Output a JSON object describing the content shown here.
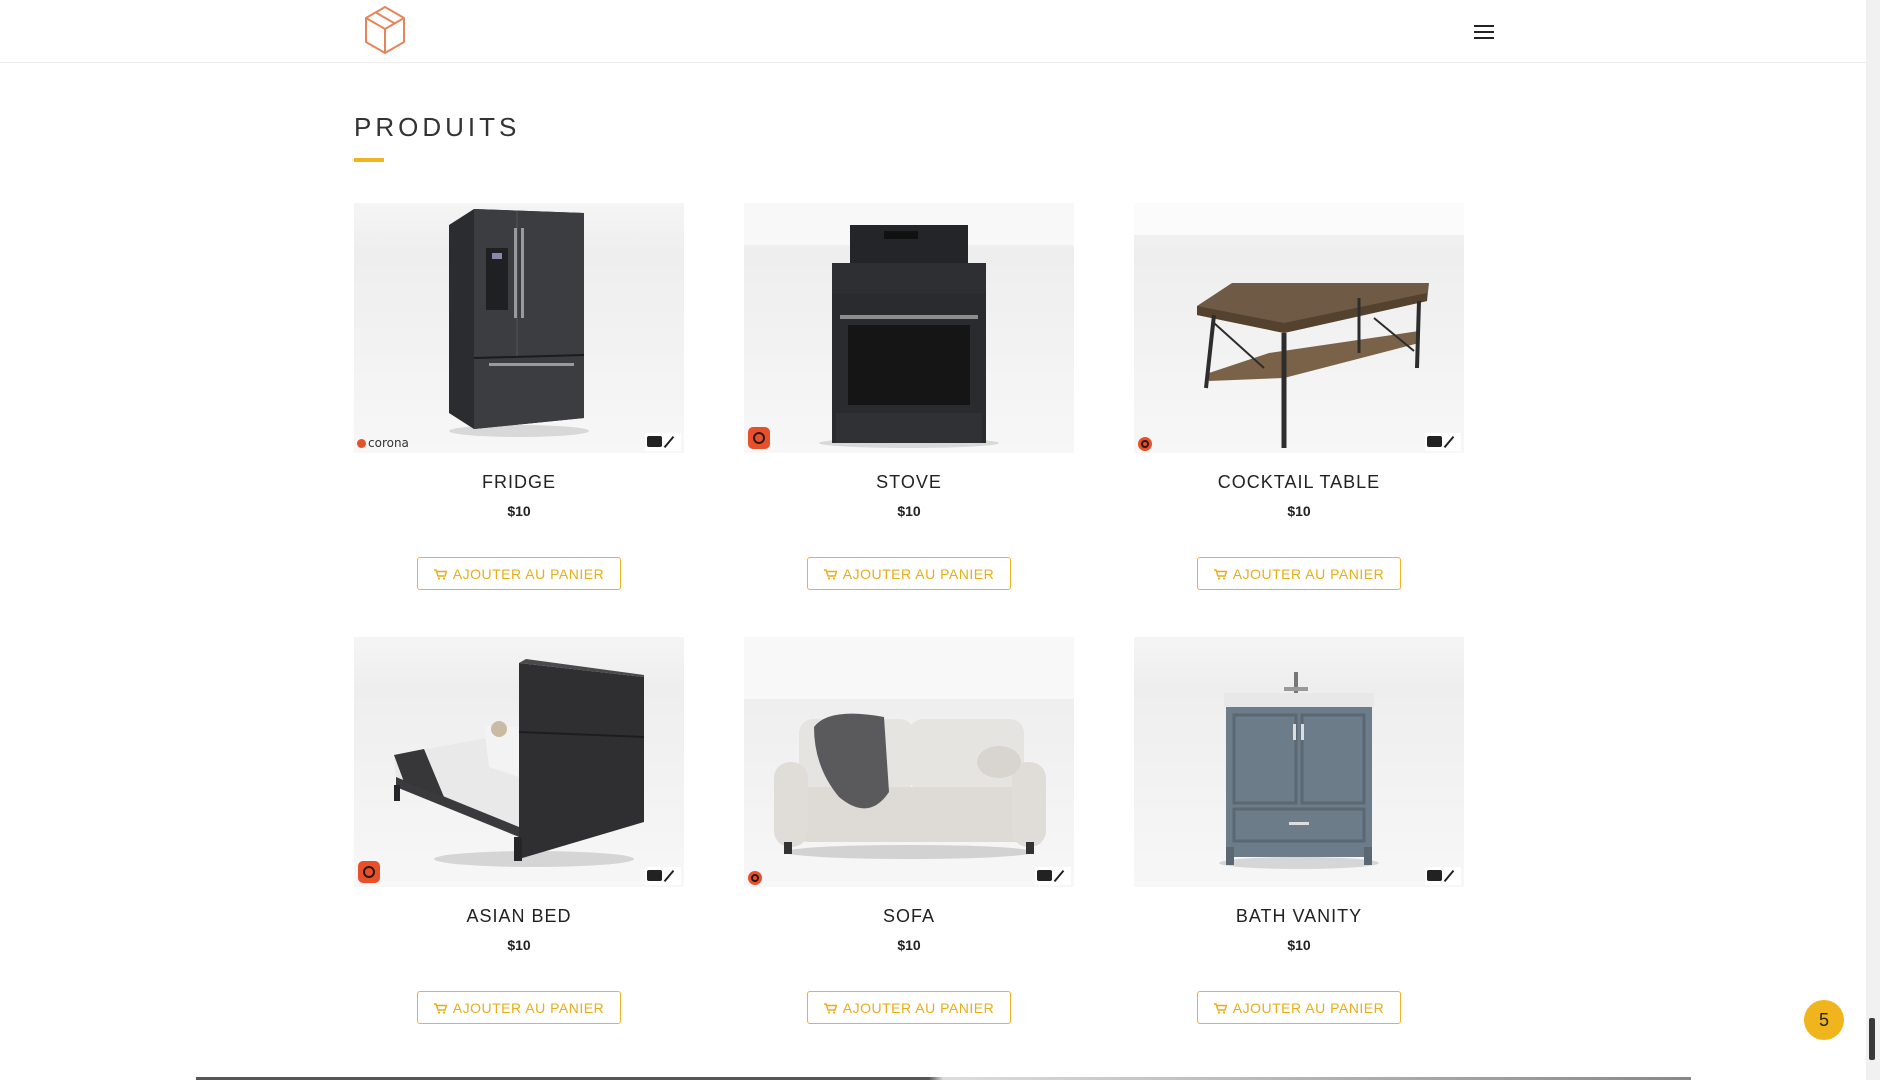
{
  "header": {
    "logo_icon": "cube-logo-icon",
    "menu_icon": "hamburger-menu-icon"
  },
  "section": {
    "title": "PRODUITS"
  },
  "products": [
    {
      "name": "FRIDGE",
      "price": "$10",
      "button_label": "AJOUTER AU PANIER",
      "image": "fridge",
      "render_badge": "corona"
    },
    {
      "name": "STOVE",
      "price": "$10",
      "button_label": "AJOUTER AU PANIER",
      "image": "stove",
      "render_badge": "corona-icon"
    },
    {
      "name": "COCKTAIL TABLE",
      "price": "$10",
      "button_label": "AJOUTER AU PANIER",
      "image": "cocktail-table",
      "render_badge": "corona-icon"
    },
    {
      "name": "ASIAN BED",
      "price": "$10",
      "button_label": "AJOUTER AU PANIER",
      "image": "asian-bed",
      "render_badge": "corona-icon"
    },
    {
      "name": "SOFA",
      "price": "$10",
      "button_label": "AJOUTER AU PANIER",
      "image": "sofa",
      "render_badge": "corona-icon"
    },
    {
      "name": "BATH VANITY",
      "price": "$10",
      "button_label": "AJOUTER AU PANIER",
      "image": "bath-vanity",
      "render_badge": "none"
    }
  ],
  "corona_label": "corona",
  "cart_counter": "5",
  "colors": {
    "accent": "#f0b51c",
    "logo": "#e8845a",
    "render_badge": "#e8502c"
  }
}
